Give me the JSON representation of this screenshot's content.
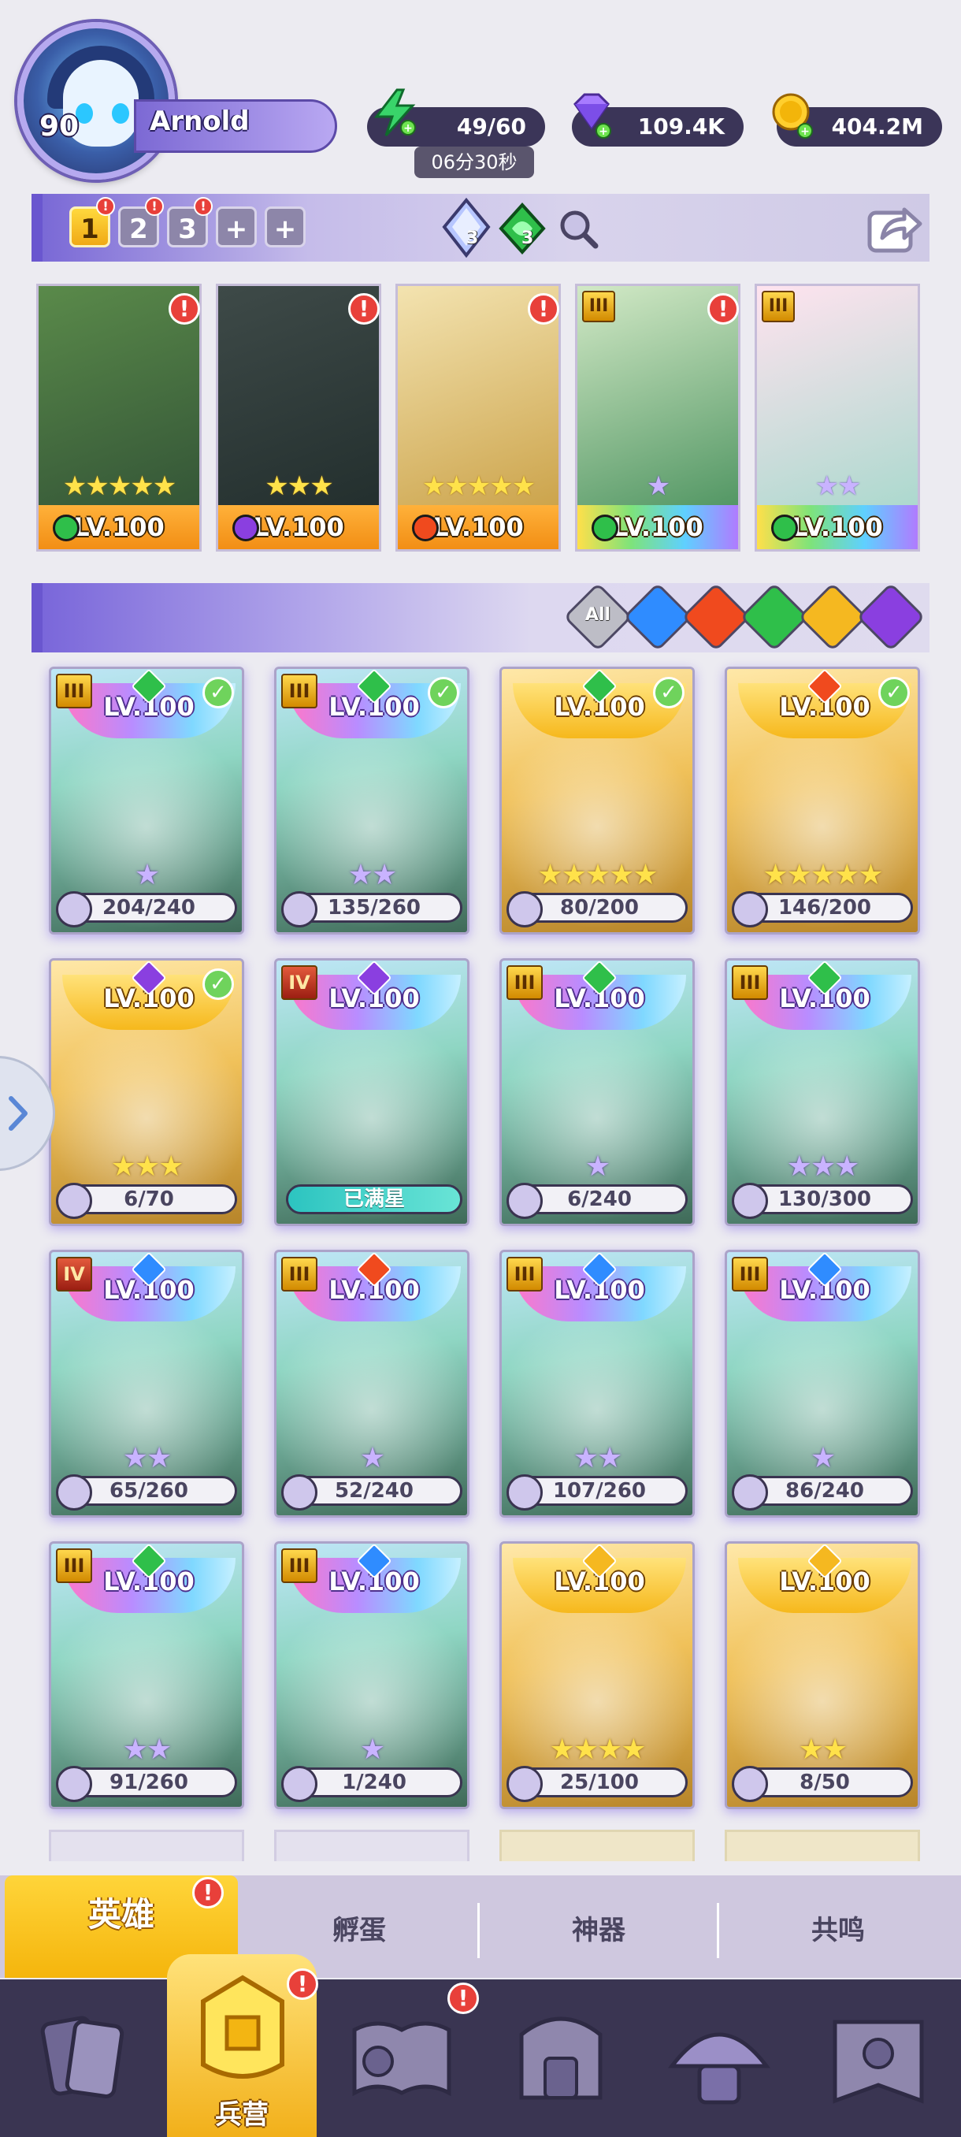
{
  "player": {
    "level": "90",
    "name": "Arnold"
  },
  "resources": {
    "energy": "49/60",
    "energy_timer": "06分30秒",
    "gems": "109.4K",
    "coins": "404.2M"
  },
  "teams": {
    "tabs": [
      "1",
      "2",
      "3"
    ],
    "add_labels": [
      "+",
      "+"
    ],
    "item_counts": [
      "3",
      "3"
    ],
    "badge": "!"
  },
  "team_heroes": [
    {
      "level": "LV.100",
      "stars": "★★★★★",
      "star_color": "gold",
      "elem": "wind"
    },
    {
      "level": "LV.100",
      "stars": "★★★",
      "star_color": "gold",
      "elem": "dark"
    },
    {
      "level": "LV.100",
      "stars": "★★★★★",
      "star_color": "gold",
      "elem": "fire"
    },
    {
      "level": "LV.100",
      "stars": "★",
      "star_color": "purple",
      "elem": "wind",
      "tier": "III"
    },
    {
      "level": "LV.100",
      "stars": "★★",
      "star_color": "purple",
      "elem": "wind",
      "tier": "III"
    }
  ],
  "filters": {
    "all_label": "All",
    "elements": [
      "water",
      "fire",
      "wind",
      "light",
      "dark"
    ]
  },
  "hero_grid": [
    {
      "tier": "III",
      "elem": "wind",
      "level": "LV.100",
      "stars": "★",
      "shards": "204/240",
      "check": true,
      "style": "rainbow"
    },
    {
      "tier": "III",
      "elem": "wind",
      "level": "LV.100",
      "stars": "★★",
      "shards": "135/260",
      "check": true,
      "style": "rainbow"
    },
    {
      "tier": "",
      "elem": "wind",
      "level": "LV.100",
      "stars": "★★★★★",
      "shards": "80/200",
      "check": true,
      "style": "gold"
    },
    {
      "tier": "",
      "elem": "fire",
      "level": "LV.100",
      "stars": "★★★★★",
      "shards": "146/200",
      "check": true,
      "style": "gold"
    },
    {
      "tier": "",
      "elem": "dark",
      "level": "LV.100",
      "stars": "★★★",
      "shards": "6/70",
      "check": true,
      "style": "gold"
    },
    {
      "tier": "IV",
      "elem": "dark",
      "level": "LV.100",
      "stars": "",
      "shards": "已满星",
      "check": false,
      "style": "rainbow"
    },
    {
      "tier": "III",
      "elem": "wind",
      "level": "LV.100",
      "stars": "★",
      "shards": "6/240",
      "check": false,
      "style": "rainbow"
    },
    {
      "tier": "III",
      "elem": "wind",
      "level": "LV.100",
      "stars": "★★★",
      "shards": "130/300",
      "check": false,
      "style": "rainbow"
    },
    {
      "tier": "IV",
      "elem": "water",
      "level": "LV.100",
      "stars": "★★",
      "shards": "65/260",
      "check": false,
      "style": "rainbow"
    },
    {
      "tier": "III",
      "elem": "fire",
      "level": "LV.100",
      "stars": "★",
      "shards": "52/240",
      "check": false,
      "style": "rainbow"
    },
    {
      "tier": "III",
      "elem": "water",
      "level": "LV.100",
      "stars": "★★",
      "shards": "107/260",
      "check": false,
      "style": "rainbow"
    },
    {
      "tier": "III",
      "elem": "water",
      "level": "LV.100",
      "stars": "★",
      "shards": "86/240",
      "check": false,
      "style": "rainbow"
    },
    {
      "tier": "III",
      "elem": "wind",
      "level": "LV.100",
      "stars": "★★",
      "shards": "91/260",
      "check": false,
      "style": "rainbow"
    },
    {
      "tier": "III",
      "elem": "water",
      "level": "LV.100",
      "stars": "★",
      "shards": "1/240",
      "check": false,
      "style": "rainbow"
    },
    {
      "tier": "",
      "elem": "light",
      "level": "LV.100",
      "stars": "★★★★",
      "shards": "25/100",
      "check": false,
      "style": "gold"
    },
    {
      "tier": "",
      "elem": "light",
      "level": "LV.100",
      "stars": "★★",
      "shards": "8/50",
      "check": false,
      "style": "gold"
    }
  ],
  "subtabs": [
    "英雄",
    "孵蛋",
    "神器",
    "共鸣"
  ],
  "nav": {
    "active_label": "兵营"
  },
  "colors": {
    "water": "#2f8cff",
    "fire": "#f04a1e",
    "wind": "#2fbf4a",
    "light": "#f5b820",
    "dark": "#8a3fe0",
    "accent": "#6a56cf"
  }
}
